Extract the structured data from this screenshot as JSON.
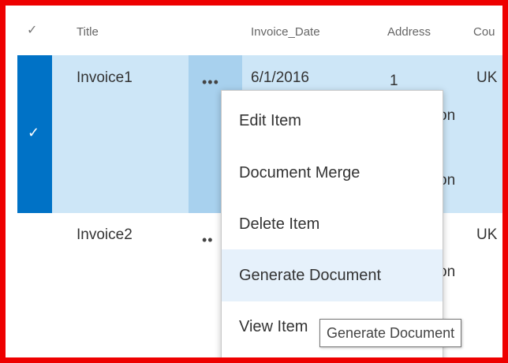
{
  "header": {
    "check_glyph": "✓",
    "columns": [
      "Title",
      "Invoice_Date",
      "Address",
      "Cou"
    ]
  },
  "rows": [
    {
      "title": "Invoice1",
      "date": "6/1/2016",
      "address": "1",
      "country": "UK",
      "dots": "•••",
      "check": "✓",
      "partial_a": "on",
      "partial_b": "on"
    },
    {
      "title": "Invoice2",
      "dots": "••",
      "country": "UK",
      "partial_a": "on"
    }
  ],
  "context_menu": {
    "items": [
      "Edit Item",
      "Document Merge",
      "Delete Item",
      "Generate Document",
      "View Item"
    ],
    "hovered": "Generate Document"
  },
  "tooltip": "Generate Document",
  "colors": {
    "selected_row": "#cde6f7",
    "select_bar": "#0072c6",
    "highlight_border": "#ee0000"
  }
}
